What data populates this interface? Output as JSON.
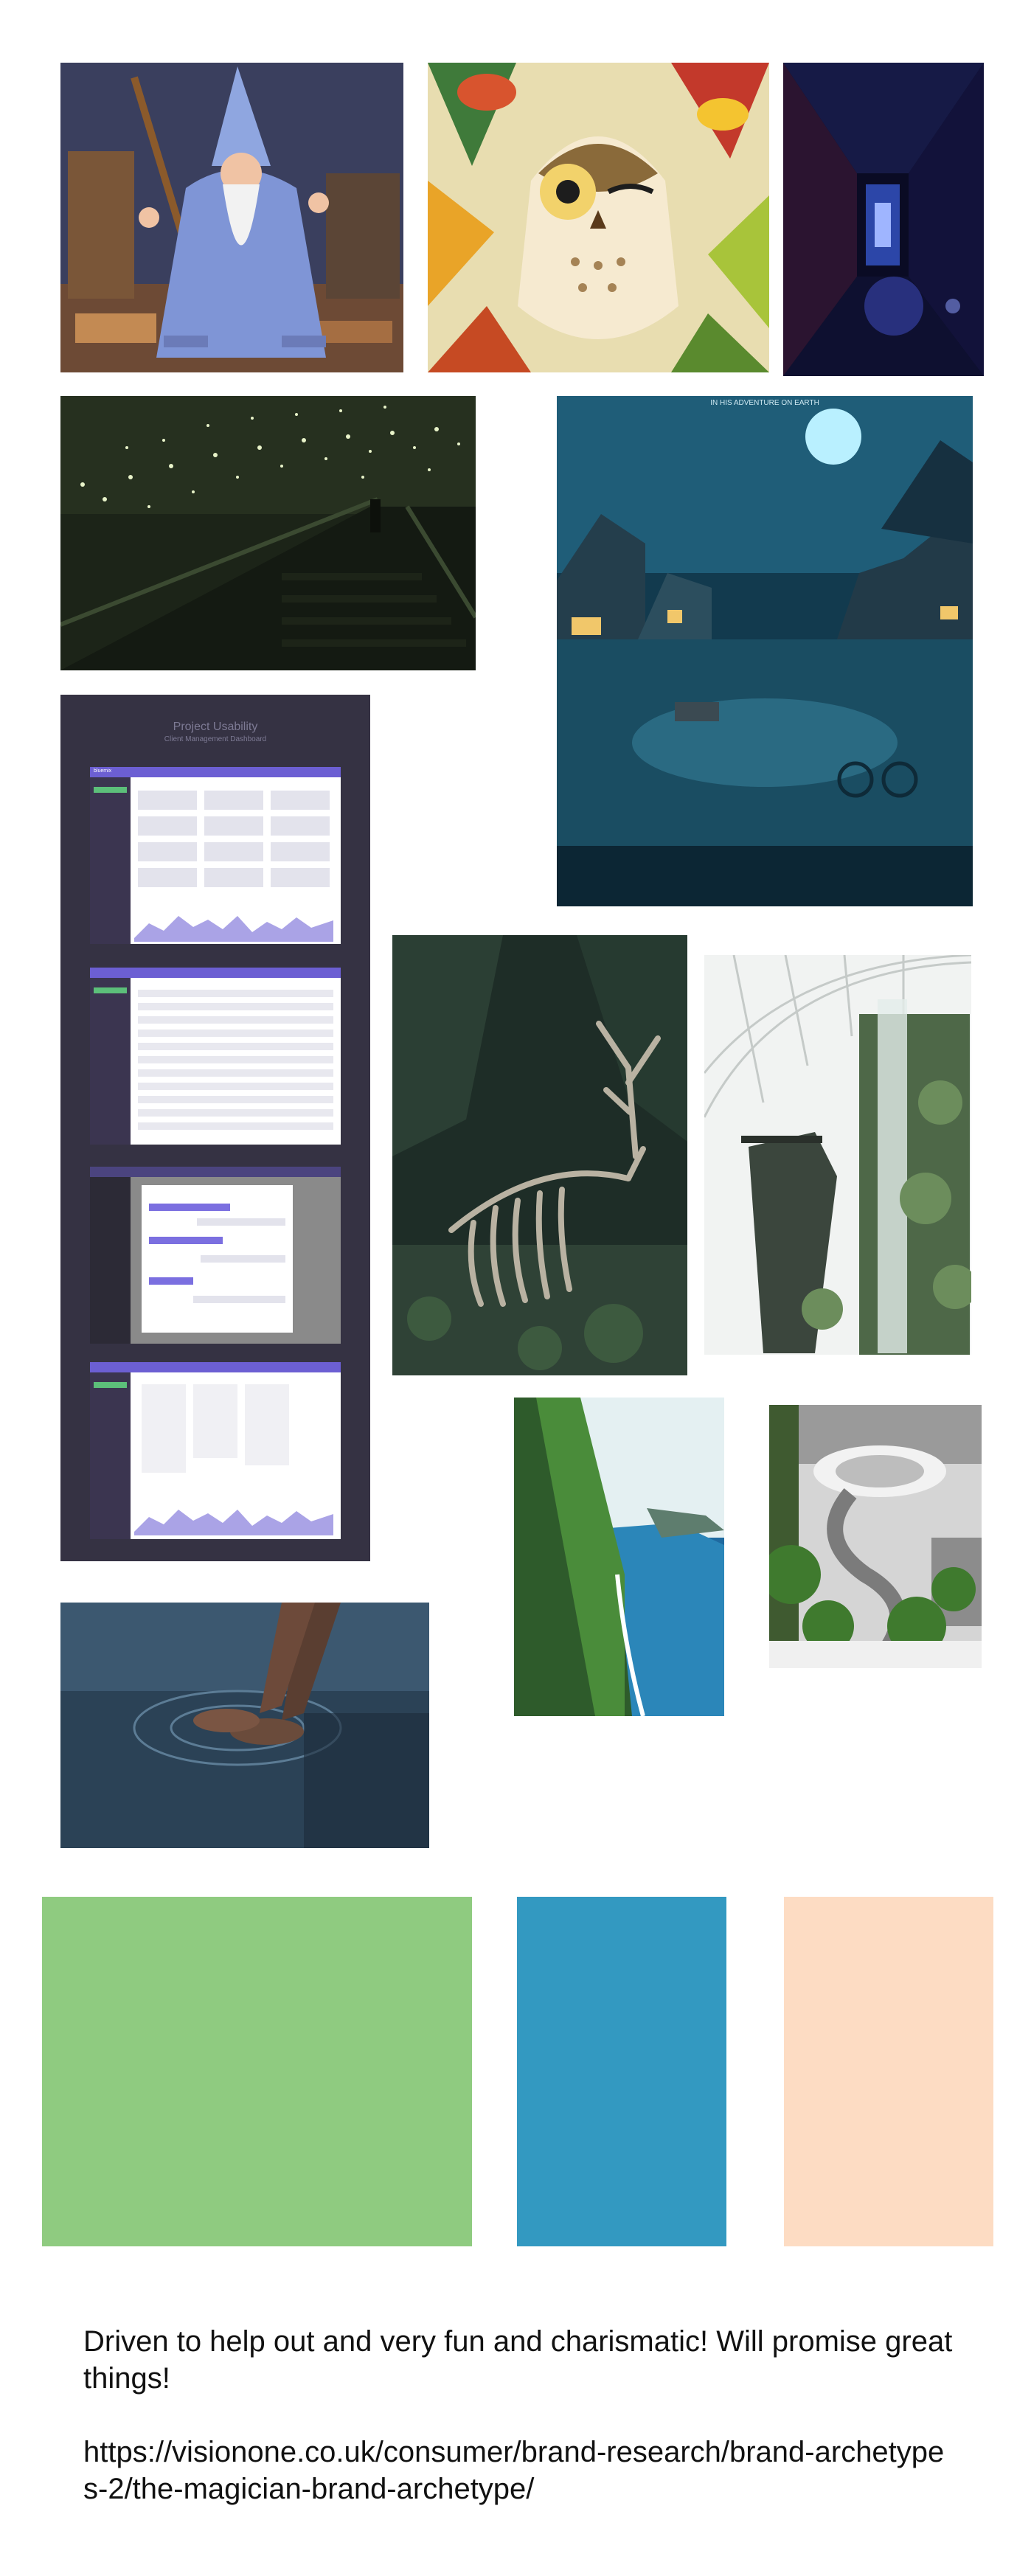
{
  "board": {
    "images": [
      {
        "id": "wizard",
        "icon": "wizard-illustration"
      },
      {
        "id": "owl",
        "icon": "owl-illustration"
      },
      {
        "id": "corridor",
        "icon": "neon-corridor-photo"
      },
      {
        "id": "stairs",
        "icon": "starry-stairwell-photo"
      },
      {
        "id": "flood",
        "icon": "flooded-town-poster",
        "caption_text": "IN HIS ADVENTURE ON EARTH"
      },
      {
        "id": "dashboard",
        "icon": "dashboard-mockups"
      },
      {
        "id": "skeleton",
        "icon": "deer-skeleton-forest-photo"
      },
      {
        "id": "greenhouse",
        "icon": "greenhouse-waterfall-photo"
      },
      {
        "id": "cliffs",
        "icon": "sea-cliffs-photo"
      },
      {
        "id": "spiral",
        "icon": "spiral-staircase-ruins-photo"
      },
      {
        "id": "water",
        "icon": "hands-in-water-photo"
      }
    ],
    "dashboard": {
      "title": "Project Usability",
      "subtitle": "Client Management Dashboard",
      "brand": "bluemix"
    },
    "swatches": [
      {
        "name": "green",
        "color": "#8fcb80"
      },
      {
        "name": "blue",
        "color": "#3399c1"
      },
      {
        "name": "peach",
        "color": "#fddcc3"
      }
    ],
    "caption": {
      "text": "Driven to help out and very fun and charismatic! Will promise great things!",
      "link": "https://visionone.co.uk/consumer/brand-research/brand-archetypes-2/the-magician-brand-archetype/"
    }
  }
}
